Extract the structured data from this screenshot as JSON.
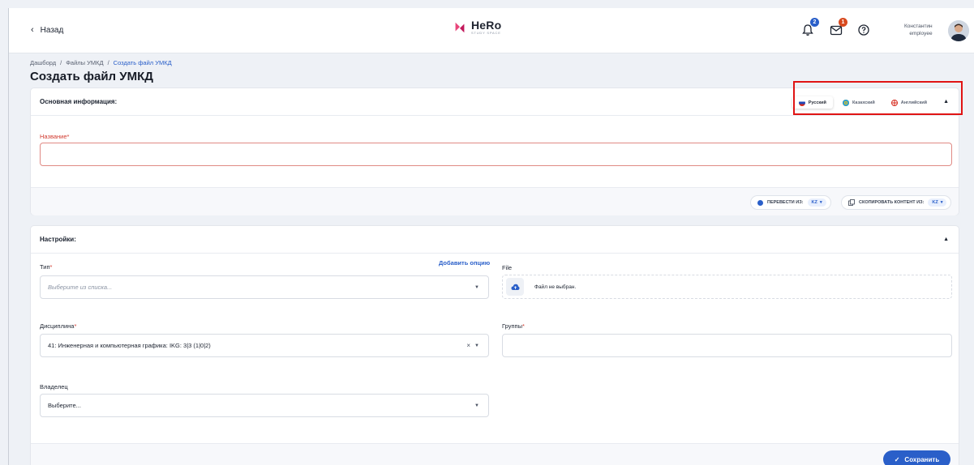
{
  "header": {
    "back_label": "Назад",
    "logo_main": "HeRo",
    "logo_sub": "STUDY SPACE",
    "notifications_count": "2",
    "messages_count": "1",
    "user_name": "Константин",
    "user_role": "employee"
  },
  "breadcrumb": {
    "items": [
      "Дашборд",
      "/",
      "Файлы УМКД",
      "/",
      "Создать файл УМКД"
    ]
  },
  "page": {
    "title": "Создать файл УМКД"
  },
  "main_info": {
    "header": "Основная информация:",
    "languages": [
      {
        "label": "Русский",
        "active": true
      },
      {
        "label": "Казахский",
        "active": false
      },
      {
        "label": "Английский",
        "active": false
      }
    ],
    "name_label": "Название",
    "name_value": "",
    "translate_label": "ПЕРЕВЕСТИ ИЗ:",
    "translate_from": "KZ",
    "copy_label": "СКОПИРОВАТЬ КОНТЕНТ ИЗ:",
    "copy_from": "KZ"
  },
  "settings": {
    "header": "Настройки:",
    "type_label": "Тип",
    "add_option": "Добавить опцию",
    "type_placeholder": "Выберите из списка...",
    "file_label": "File",
    "file_status": "Файл не выбран.",
    "discipline_label": "Дисциплина",
    "discipline_value": "41: Инженерная и компьютерная графика: IKG: 3|3 (1|0|2)",
    "groups_label": "Группы",
    "groups_value": "",
    "owner_label": "Владелец",
    "owner_value": "Выберите..."
  },
  "actions": {
    "save_label": "Сохранить"
  },
  "colors": {
    "accent": "#2a5fc9",
    "error": "#d13a2f",
    "highlight": "#e01414"
  }
}
